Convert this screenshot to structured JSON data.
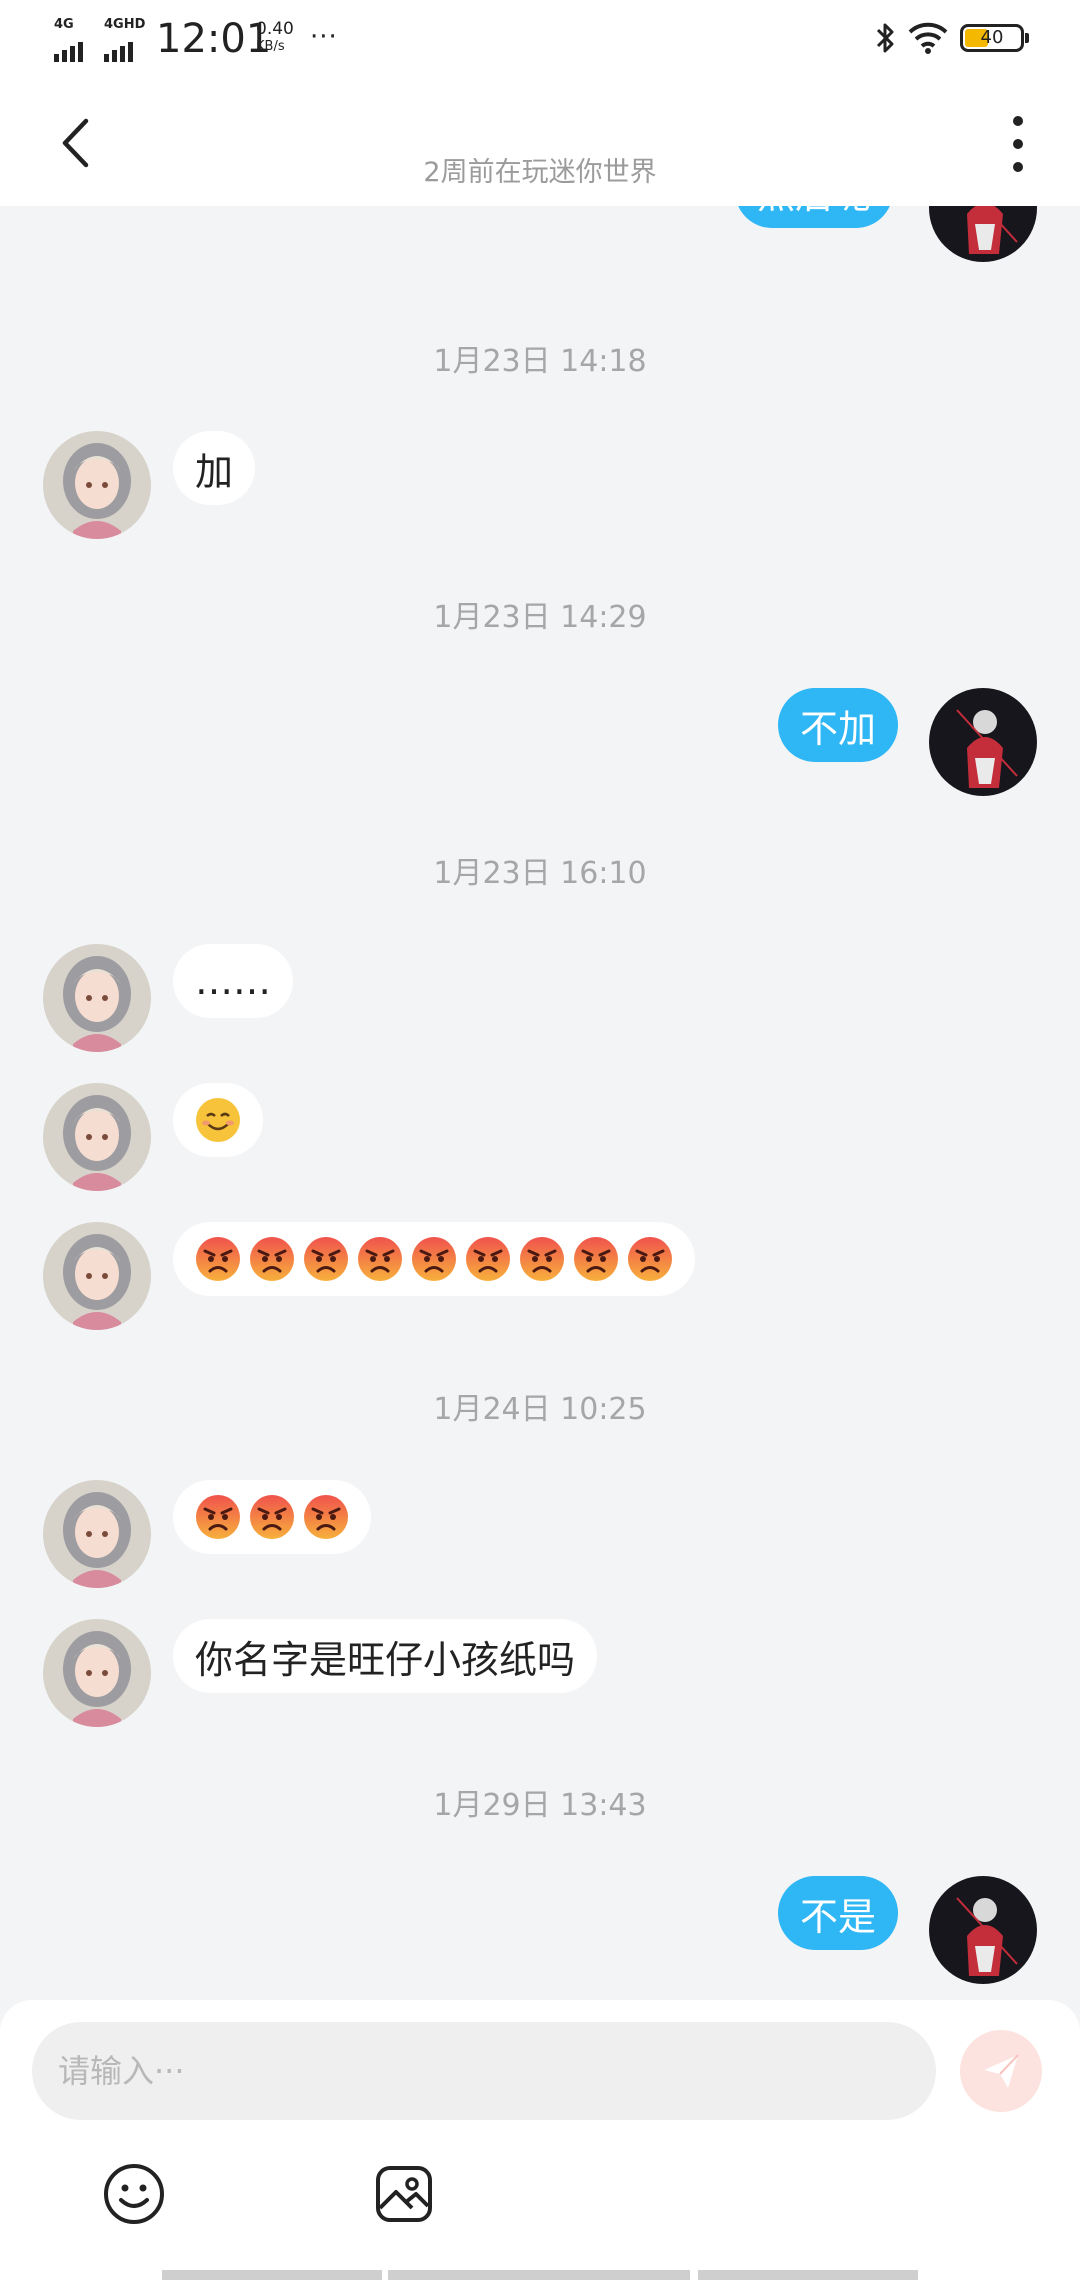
{
  "status_bar": {
    "sim1": "4G",
    "sim2": "4GHD",
    "time": "12:01",
    "net_speed": "0.40",
    "net_unit": "KB/s",
    "more": "···",
    "battery": "40",
    "icons": [
      "signal-icon",
      "bluetooth-icon",
      "wifi-icon",
      "battery-icon"
    ]
  },
  "header": {
    "back_icon": "chevron-left-icon",
    "subtitle": "2周前在玩迷你世界",
    "more_icon": "more-vertical-icon"
  },
  "chat": {
    "partial_top_message": "然后呢",
    "groups": [
      {
        "timestamp": "1月23日 14:18",
        "messages": [
          {
            "from": "other",
            "text": "加"
          }
        ]
      },
      {
        "timestamp": "1月23日 14:29",
        "messages": [
          {
            "from": "me",
            "text": "不加"
          }
        ]
      },
      {
        "timestamp": "1月23日 16:10",
        "messages": [
          {
            "from": "other",
            "text": "……"
          },
          {
            "from": "other",
            "emoji": "smiling-face",
            "count": 1
          },
          {
            "from": "other",
            "emoji": "angry-face",
            "count": 9
          }
        ]
      },
      {
        "timestamp": "1月24日 10:25",
        "messages": [
          {
            "from": "other",
            "emoji": "angry-face",
            "count": 3
          },
          {
            "from": "other",
            "text": "你名字是旺仔小孩纸吗"
          }
        ]
      },
      {
        "timestamp": "1月29日 13:43",
        "messages": [
          {
            "from": "me",
            "text": "不是"
          }
        ]
      }
    ]
  },
  "input": {
    "placeholder": "请输入···",
    "send_icon": "send-icon",
    "toolbar_icons": [
      "emoji-icon",
      "image-icon"
    ]
  },
  "colors": {
    "outgoing_bubble": "#2eb6f5",
    "incoming_bubble": "#ffffff",
    "background": "#f3f4f6",
    "send_button": "#fde3e0",
    "battery_fill": "#f5b800"
  }
}
